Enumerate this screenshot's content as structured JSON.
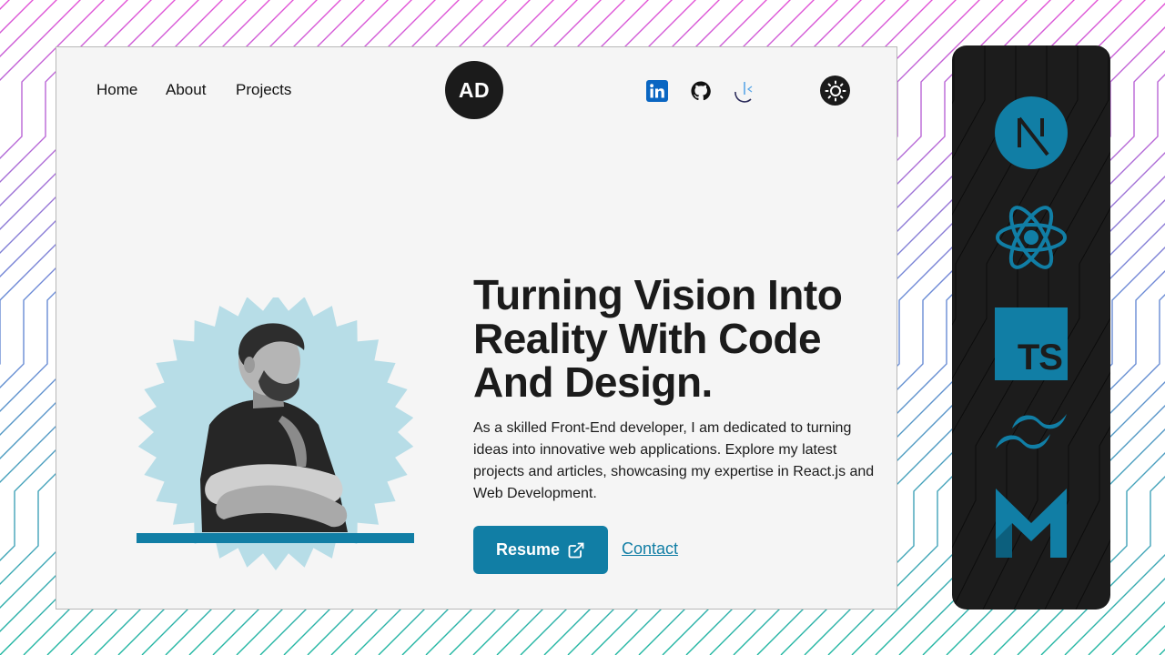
{
  "nav": {
    "home": "Home",
    "about": "About",
    "projects": "Projects"
  },
  "logo": {
    "text": "AD"
  },
  "social": {
    "icons": [
      "linkedin-icon",
      "github-icon",
      "dev-icon"
    ],
    "theme_icon": "sun-icon"
  },
  "hero": {
    "headline": "Turning Vision Into Reality With Code And Design.",
    "description": "As a skilled Front-End developer, I am dedicated to turning ideas into innovative web applications. Explore my latest projects and articles, showcasing my expertise in React.js and Web Development.",
    "resume_label": "Resume",
    "contact_label": "Contact"
  },
  "tech_stack": {
    "icons": [
      "nextjs-icon",
      "react-icon",
      "typescript-icon",
      "tailwind-icon",
      "mui-icon"
    ],
    "ts_label": "TS"
  },
  "colors": {
    "accent": "#117ea5",
    "dark": "#1b1b1b",
    "light_bg": "#f5f5f5",
    "starburst": "#b7dde7"
  }
}
